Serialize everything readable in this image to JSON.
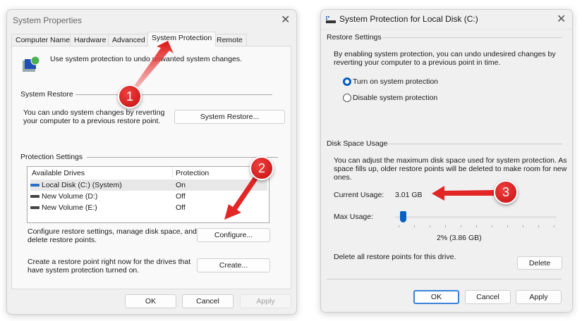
{
  "system_properties": {
    "title": "System Properties",
    "tabs": [
      "Computer Name",
      "Hardware",
      "Advanced",
      "System Protection",
      "Remote"
    ],
    "active_tab": "System Protection",
    "intro": "Use system protection to undo unwanted system changes.",
    "system_restore": {
      "heading": "System Restore",
      "text1": "You can undo system changes by reverting",
      "text2": "your computer to a previous restore point.",
      "button": "System Restore..."
    },
    "protection_settings": {
      "heading": "Protection Settings",
      "columns": [
        "Available Drives",
        "Protection"
      ],
      "drives": [
        {
          "name": "Local Disk (C:) (System)",
          "protection": "On"
        },
        {
          "name": "New Volume (D:)",
          "protection": "Off"
        },
        {
          "name": "New Volume (E:)",
          "protection": "Off"
        }
      ],
      "configure_text1": "Configure restore settings, manage disk space, and",
      "configure_text2": "delete restore points.",
      "configure_button": "Configure...",
      "create_text1": "Create a restore point right now for the drives that",
      "create_text2": "have system protection turned on.",
      "create_button": "Create..."
    },
    "buttons": {
      "ok": "OK",
      "cancel": "Cancel",
      "apply": "Apply"
    }
  },
  "protection_dialog": {
    "title": "System Protection for Local Disk (C:)",
    "restore_settings": {
      "heading": "Restore Settings",
      "text1": "By enabling system protection, you can undo undesired changes by",
      "text2": "reverting your computer to a previous point in time.",
      "option_on": "Turn on system protection",
      "option_off": "Disable system protection",
      "selected": "on"
    },
    "disk_space": {
      "heading": "Disk Space Usage",
      "text1": "You can adjust the maximum disk space used for system protection. As",
      "text2": "space fills up, older restore points will be deleted to make room for new",
      "text3": "ones.",
      "current_label": "Current Usage:",
      "current_value": "3.01 GB",
      "max_label": "Max Usage:",
      "max_percent": 2,
      "max_value_text": "2% (3.86 GB)",
      "delete_text": "Delete all restore points for this drive.",
      "delete_button": "Delete"
    },
    "buttons": {
      "ok": "OK",
      "cancel": "Cancel",
      "apply": "Apply"
    }
  },
  "annotations": [
    "1",
    "2",
    "3"
  ],
  "colors": {
    "accent": "#0a5fc0",
    "annotation": "#d91a1a"
  }
}
